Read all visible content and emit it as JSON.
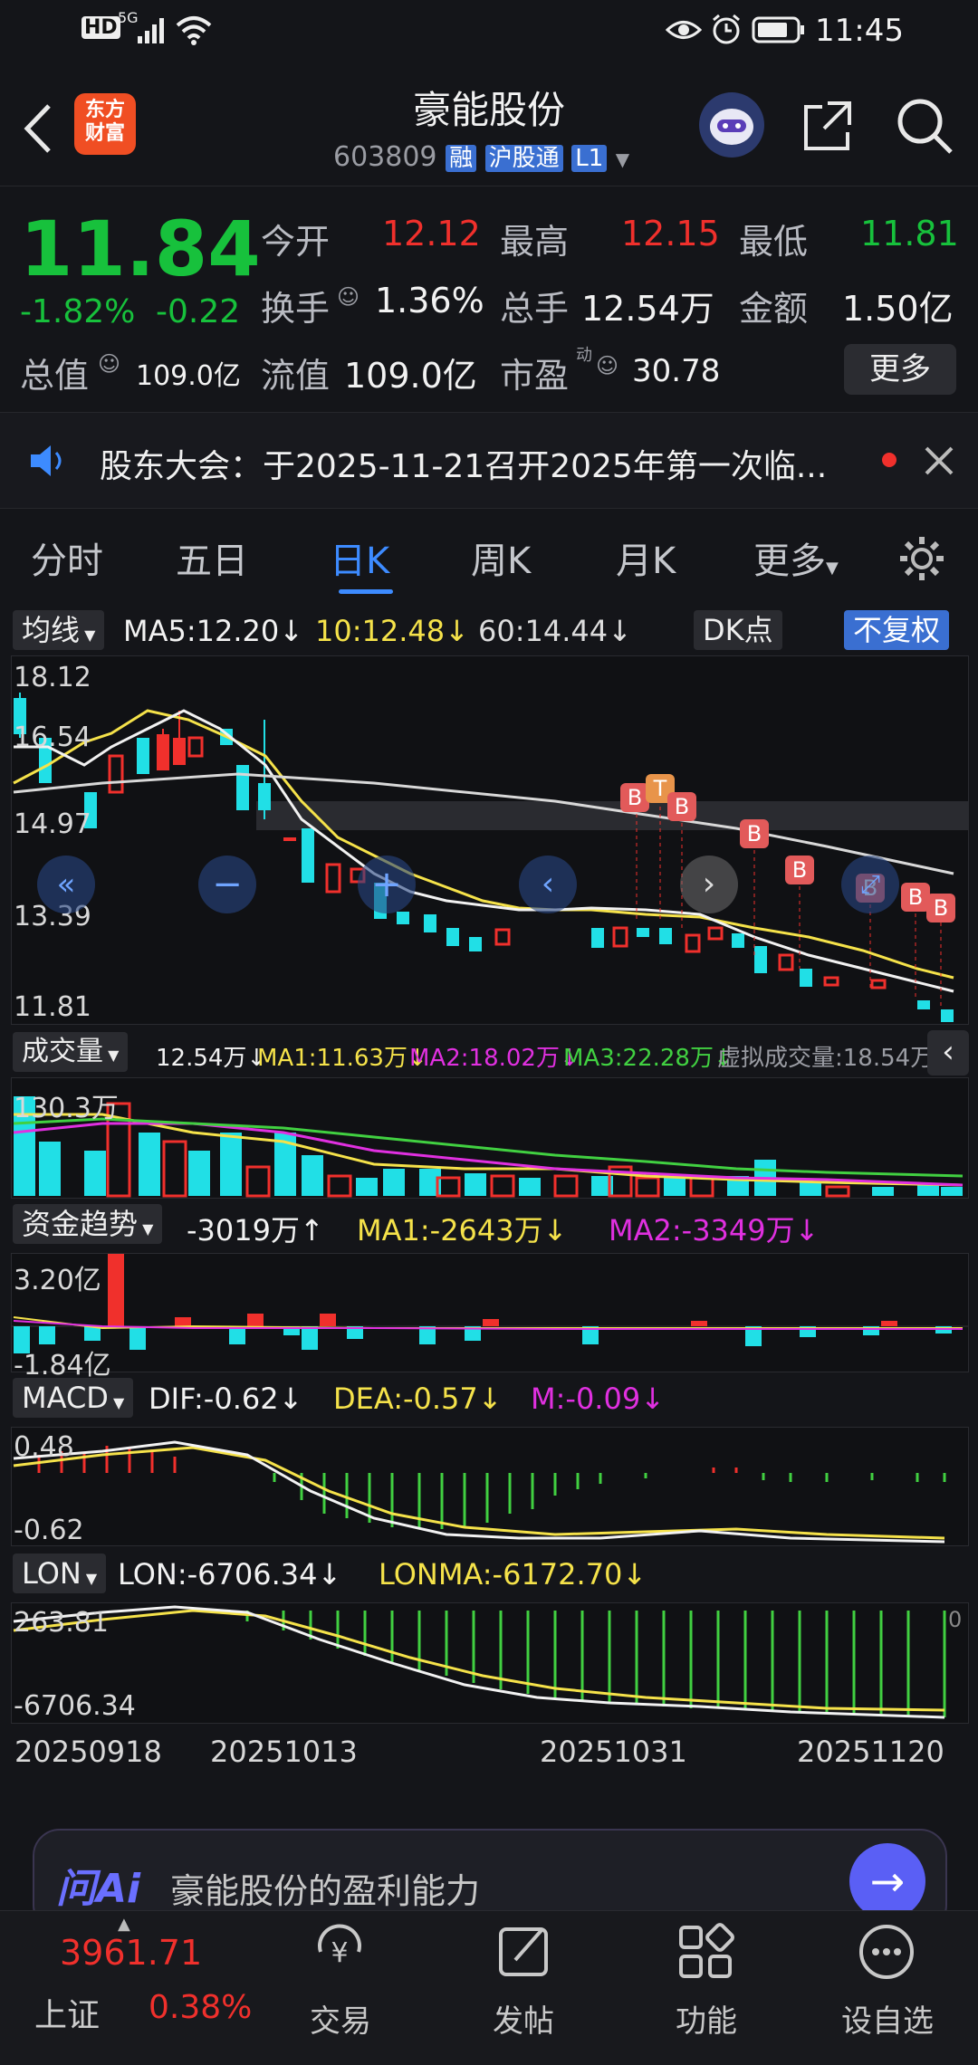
{
  "status_bar": {
    "time": "11:45",
    "hd": "HD",
    "net": "5G"
  },
  "header": {
    "logo_line1": "东方",
    "logo_line2": "财富",
    "stock_name": "豪能股份",
    "stock_code": "603809",
    "badge_rong": "融",
    "badge_hgt": "沪股通",
    "badge_l1": "L1"
  },
  "quote": {
    "price": "11.84",
    "change_pct": "-1.82%",
    "change_abs": "-0.22",
    "open_label": "今开",
    "open": "12.12",
    "high_label": "最高",
    "high": "12.15",
    "low_label": "最低",
    "low": "11.81",
    "turnover_label": "换手",
    "turnover": "1.36%",
    "volume_label": "总手",
    "volume": "12.54万",
    "amount_label": "金额",
    "amount": "1.50亿",
    "mktcap_label": "总值",
    "mktcap": "109.0亿",
    "float_label": "流值",
    "float": "109.0亿",
    "pe_label": "市盈",
    "pe_sup": "动",
    "pe": "30.78",
    "more": "更多"
  },
  "notice": {
    "text": "股东大会：于2025-11-21召开2025年第一次临..."
  },
  "tabs": [
    {
      "label": "分时"
    },
    {
      "label": "五日"
    },
    {
      "label": "日K"
    },
    {
      "label": "周K"
    },
    {
      "label": "月K"
    },
    {
      "label": "更多"
    }
  ],
  "ma_row": {
    "selector": "均线",
    "ma5": "MA5:12.20",
    "ma10": "10:12.48",
    "ma60": "60:14.44",
    "dk": "DK点",
    "fq": "不复权"
  },
  "kline": {
    "y_ticks": [
      "18.12",
      "16.54",
      "14.97",
      "13.39",
      "11.81"
    ],
    "markers": [
      "B",
      "T",
      "B",
      "B",
      "B",
      "B",
      "B",
      "B"
    ]
  },
  "vol_row": {
    "selector": "成交量",
    "value": "12.54万",
    "ma1": "MA1:11.63万",
    "ma2": "MA2:18.02万",
    "ma3": "MA3:22.28万",
    "virtual": "虚拟成交量:18.54万",
    "y_top": "130.3万"
  },
  "fund_row": {
    "selector": "资金趋势",
    "value": "-3019万",
    "ma1": "MA1:-2643万",
    "ma2": "MA2:-3349万",
    "y_top": "3.20亿",
    "y_bottom": "-1.84亿"
  },
  "macd_row": {
    "selector": "MACD",
    "dif": "DIF:-0.62",
    "dea": "DEA:-0.57",
    "m": "M:-0.09",
    "y_top": "0.48",
    "y_bottom": "-0.62"
  },
  "lon_row": {
    "selector": "LON",
    "lon": "LON:-6706.34",
    "lonma": "LONMA:-6172.70",
    "y_top": "263.81",
    "y_bottom": "-6706.34",
    "y_right": "0"
  },
  "dates": [
    "20250918",
    "20251013",
    "20251031",
    "20251120"
  ],
  "ai_bar": {
    "brand": "问Ai",
    "prompt": "豪能股份的盈利能力"
  },
  "bottom_nav": {
    "index_value": "3961.71",
    "index_name": "上证",
    "index_pct": "0.38%",
    "items": [
      {
        "label": "交易"
      },
      {
        "label": "发帖"
      },
      {
        "label": "功能"
      },
      {
        "label": "设自选"
      }
    ]
  },
  "colors": {
    "up": "#f0302c",
    "down": "#21dfe6",
    "price_down": "#17c13c",
    "accent": "#3d8bff"
  }
}
